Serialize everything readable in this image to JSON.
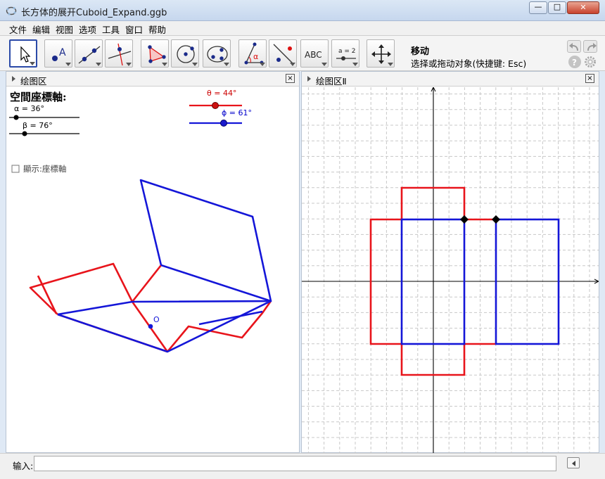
{
  "window": {
    "title": "长方体的展开Cuboid_Expand.ggb",
    "min_symbol": "—",
    "max_symbol": "□",
    "close_symbol": "✕"
  },
  "menu": [
    "文件",
    "编辑",
    "视图",
    "选项",
    "工具",
    "窗口",
    "帮助"
  ],
  "toolbar": {
    "active_tool_name": "移动",
    "active_tool_help": "选择或拖动对象(快捷键: Esc)",
    "tool_text": {
      "point_label": "A",
      "angle_label": "α",
      "text_tool": "ABC",
      "slider_tool": "a = 2"
    },
    "icons": [
      "move-icon",
      "point-icon",
      "line-icon",
      "perpendicular-icon",
      "polygon-icon",
      "circle-icon",
      "conic-icon",
      "angle-icon",
      "reflect-icon",
      "text-icon",
      "slider-icon",
      "move-view-icon"
    ]
  },
  "graphics1": {
    "header": "绘图区",
    "close": "×",
    "heading": "空間座標軸:",
    "slider_alpha": "α = 36°",
    "slider_beta": "β = 76°",
    "slider_theta": "θ = 44°",
    "slider_phi": "ϕ = 61°",
    "checkbox_label": "顯示:座標軸",
    "point_label": "O",
    "colors": {
      "red": "#e8141b",
      "blue": "#1416d8",
      "theta": "#cc0000",
      "phi": "#0000cc"
    }
  },
  "graphics2": {
    "header": "绘图区Ⅱ",
    "close": "×"
  },
  "input": {
    "label": "输入:",
    "value": ""
  }
}
